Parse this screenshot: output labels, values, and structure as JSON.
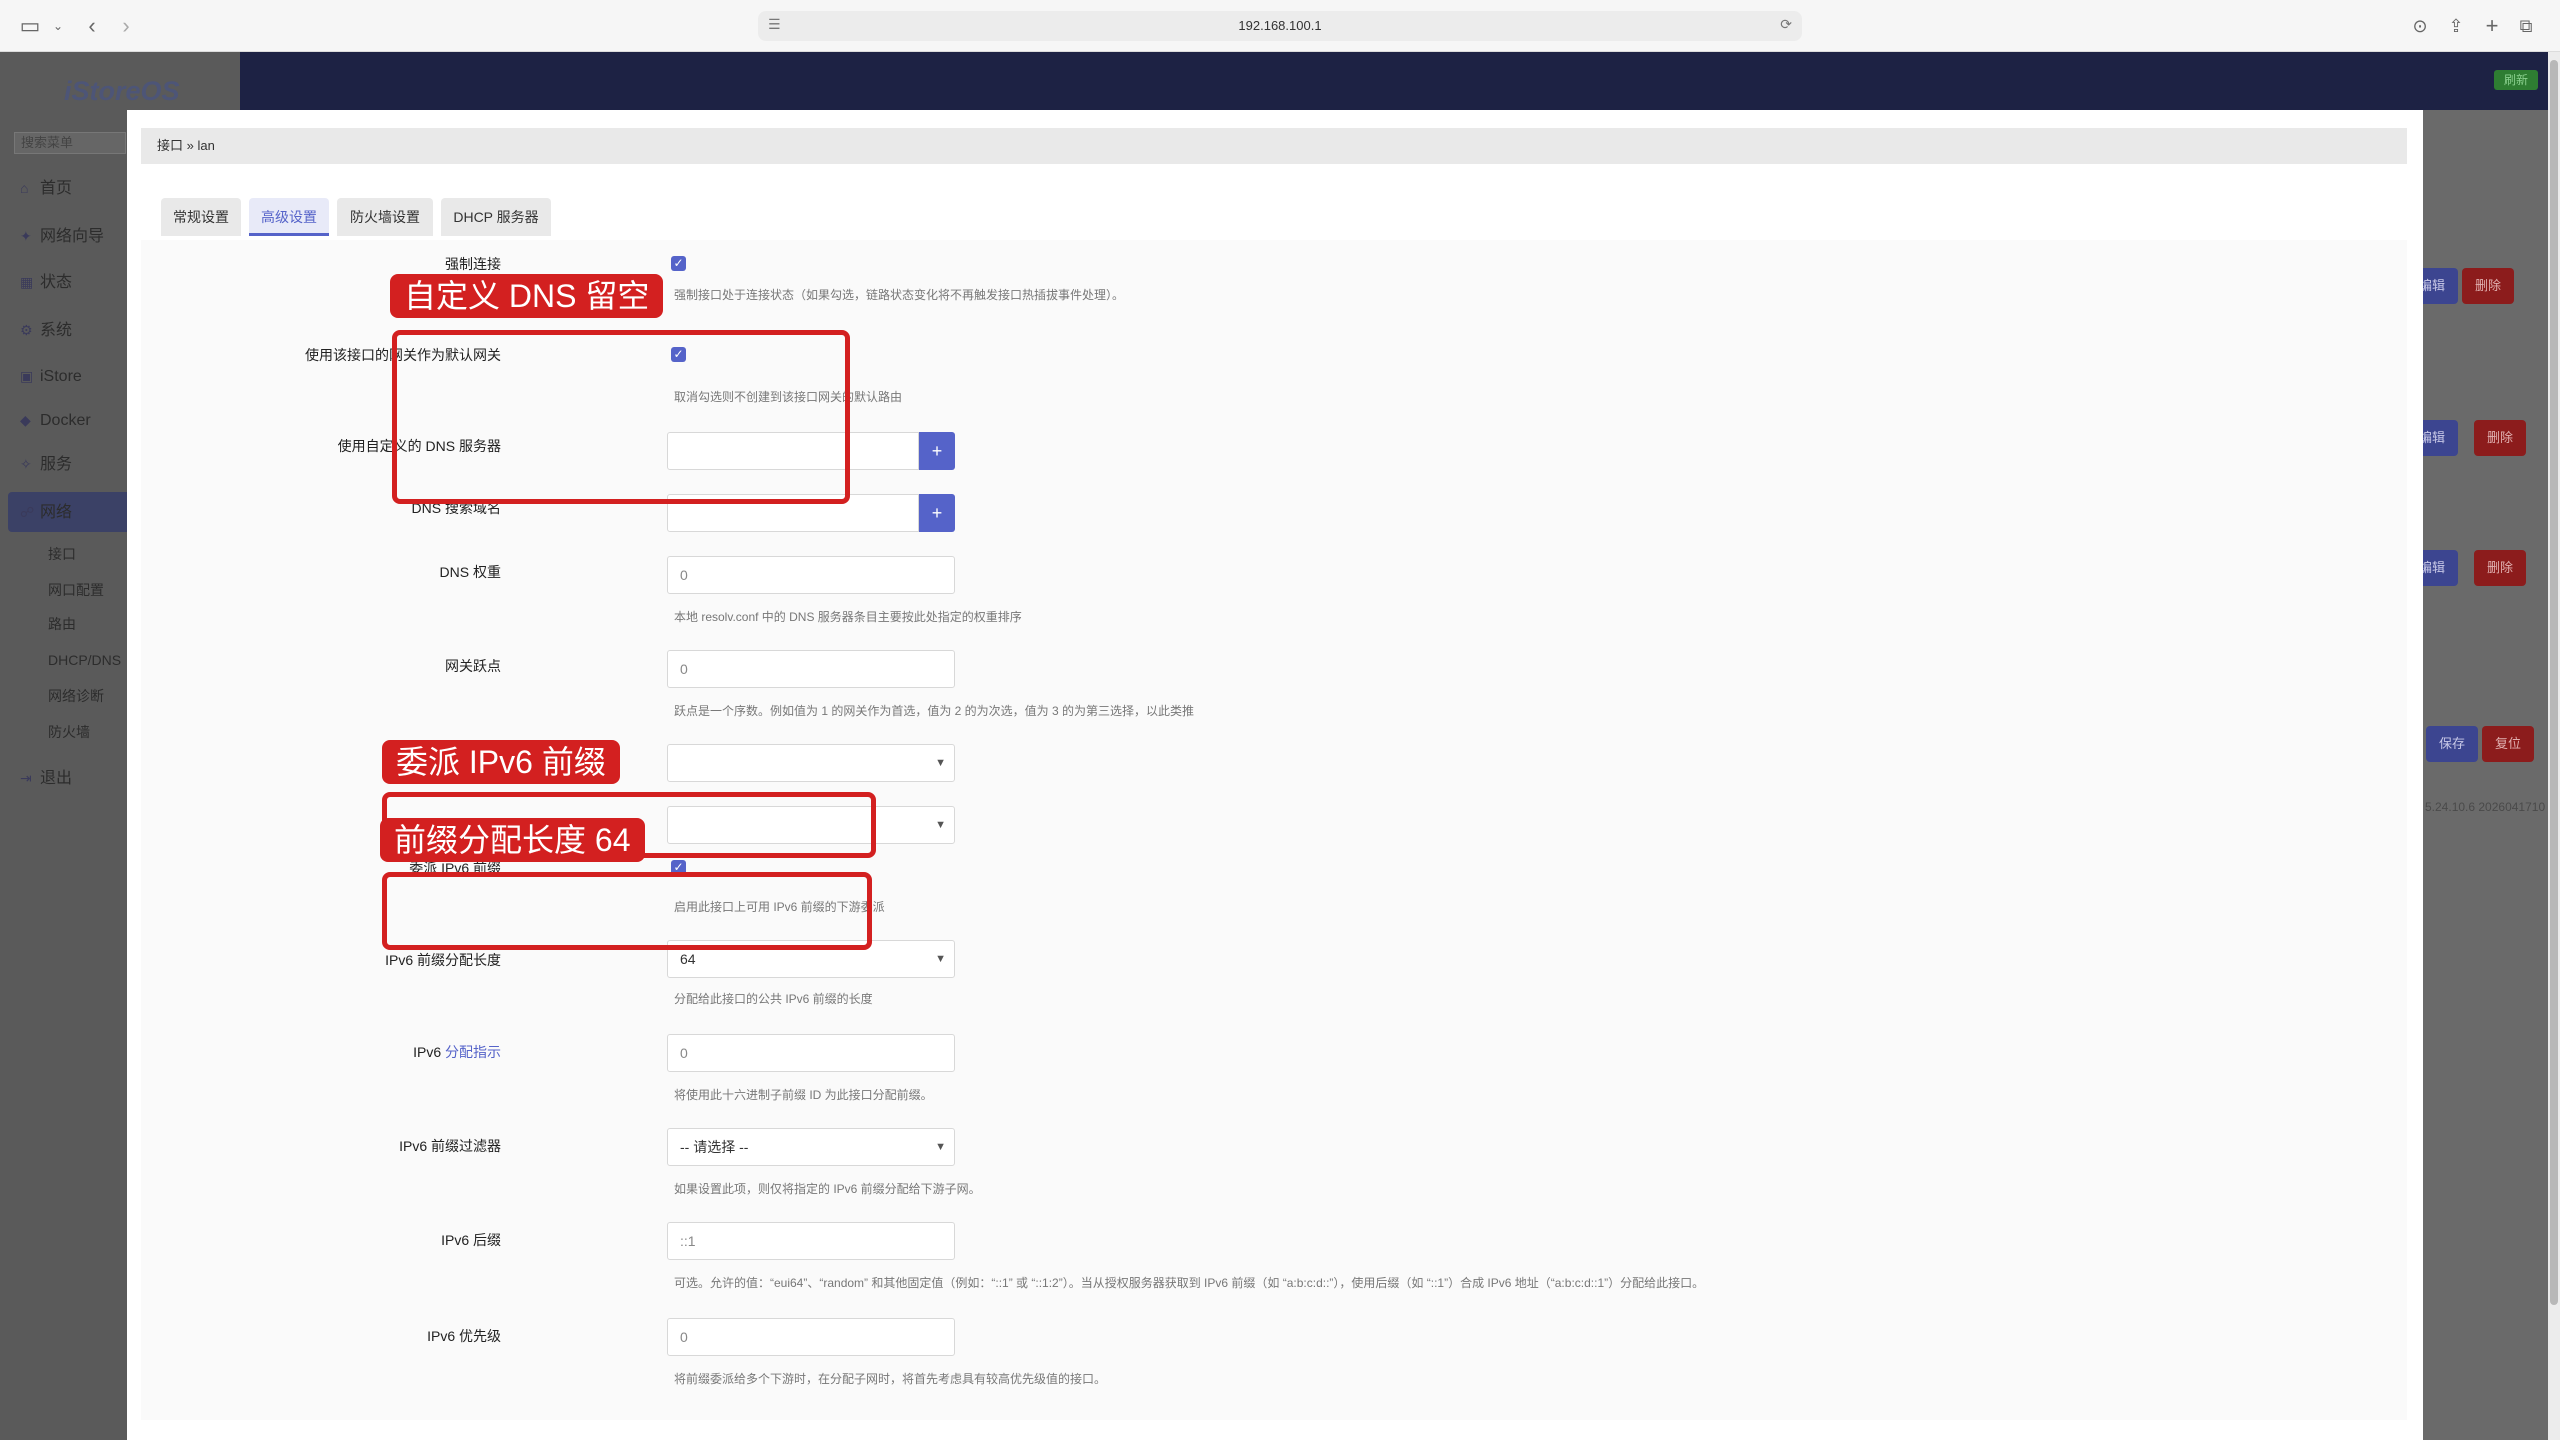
{
  "browser": {
    "url": "192.168.100.1",
    "icons": [
      "sidebar-toggle-icon",
      "chevron-down-icon",
      "back-icon",
      "forward-icon",
      "page-icon",
      "translate-icon",
      "reload-icon",
      "download-icon",
      "share-icon",
      "new-tab-icon",
      "tabs-overview-icon"
    ]
  },
  "app": {
    "brand": "iStoreOS",
    "search_placeholder": "搜索菜单",
    "nav": [
      {
        "label": "首页",
        "icon": "home-icon"
      },
      {
        "label": "网络向导",
        "icon": "wizard-icon"
      },
      {
        "label": "状态",
        "icon": "status-icon"
      },
      {
        "label": "系统",
        "icon": "gear-icon"
      },
      {
        "label": "iStore",
        "icon": "store-icon"
      },
      {
        "label": "Docker",
        "icon": "docker-icon"
      },
      {
        "label": "服务",
        "icon": "services-icon"
      },
      {
        "label": "网络",
        "icon": "network-icon"
      }
    ],
    "sub_nav": [
      "接口",
      "网口配置",
      "路由",
      "DHCP/DNS",
      "网络诊断",
      "防火墙"
    ],
    "logout": "退出",
    "top_badge": "刷新",
    "bg_buttons": {
      "edit": "编辑",
      "delete": "删除",
      "save": "保存",
      "reset": "复位"
    },
    "version": "5.24.10.6 2026041710"
  },
  "modal": {
    "breadcrumb": "接口 » lan",
    "tabs": [
      "常规设置",
      "高级设置",
      "防火墙设置",
      "DHCP 服务器"
    ],
    "active_tab": "高级设置",
    "fields": {
      "force_link": {
        "label": "强制连接",
        "checked": true,
        "help": "强制接口处于连接状态（如果勾选，链路状态变化将不再触发接口热插拔事件处理）。"
      },
      "default_gw": {
        "label": "使用该接口的网关作为默认网关",
        "checked": true,
        "help": "取消勾选则不创建到该接口网关的默认路由"
      },
      "custom_dns": {
        "label": "使用自定义的 DNS 服务器",
        "value": "",
        "add": "+"
      },
      "dns_search": {
        "label": "DNS 搜索域名",
        "value": "",
        "add": "+"
      },
      "dns_weight": {
        "label": "DNS 权重",
        "placeholder": "0",
        "help": "本地 resolv.conf 中的 DNS 服务器条目主要按此处指定的权重排序"
      },
      "gw_metric": {
        "label": "网关跃点",
        "placeholder": "0",
        "help": "跃点是一个序数。例如值为 1 的网关作为首选，值为 2 的为次选，值为 3 的为第三选择，以此类推"
      },
      "delegate": {
        "label": "委派 IPv6 前缀",
        "checked": true,
        "help": "启用此接口上可用 IPv6 前缀的下游委派"
      },
      "prefix_len": {
        "label": "IPv6 前缀分配长度",
        "value": "64",
        "help": "分配给此接口的公共 IPv6 前缀的长度"
      },
      "assign_hint": {
        "label_pre": "IPv6 ",
        "label_link": "分配指示",
        "placeholder": "0",
        "help": "将使用此十六进制子前缀 ID 为此接口分配前缀。"
      },
      "prefix_filter": {
        "label": "IPv6 前缀过滤器",
        "value": "-- 请选择 --",
        "help": "如果设置此项，则仅将指定的 IPv6 前缀分配给下游子网。"
      },
      "suffix": {
        "label": "IPv6 后缀",
        "placeholder": "::1",
        "help": "可选。允许的值：“eui64”、“random” 和其他固定值（例如：“::1” 或 “::1:2”）。当从授权服务器获取到 IPv6 前缀（如 “a:b:c:d::”），使用后缀（如 “::1”）合成 IPv6 地址（“a:b:c:d::1”）分配给此接口。"
      },
      "priority": {
        "label": "IPv6 优先级",
        "placeholder": "0",
        "help": "将前缀委派给多个下游时，在分配子网时，将首先考虑具有较高优先级值的接口。"
      }
    }
  },
  "annotations": {
    "dns": "自定义 DNS 留空",
    "delegate": "委派 IPv6 前缀",
    "prefix": "前缀分配长度 64",
    "color": "#d32020"
  }
}
